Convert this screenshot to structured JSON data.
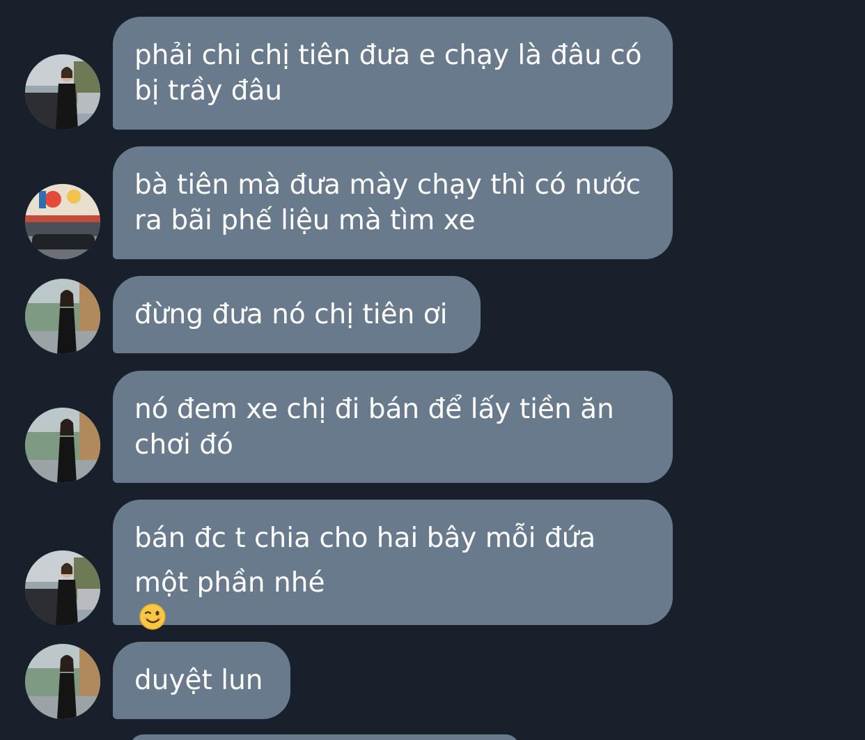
{
  "messages": [
    {
      "avatar": "avatar-photo-black-outfit-street",
      "lines": [
        "phải chi chị tiên đưa e chạy là đâu có",
        "bị trầy đâu"
      ]
    },
    {
      "avatar": "avatar-photo-colorful-storefront",
      "lines": [
        "bà tiên mà đưa mày chạy thì có nước",
        "ra bãi phế liệu mà tìm xe"
      ]
    },
    {
      "avatar": "avatar-photo-black-dress-riverside",
      "lines": [
        "đừng đưa nó chị tiên ơi"
      ]
    },
    {
      "avatar": "avatar-photo-black-dress-riverside",
      "lines": [
        "nó đem xe chị đi bán để lấy tiền ăn",
        "chơi đó"
      ]
    },
    {
      "avatar": "avatar-photo-black-outfit-street",
      "lines": [
        "bán đc t chia cho hai bây mỗi đứa",
        "một phần nhé"
      ],
      "emoji": "winking-face-emoji"
    },
    {
      "avatar": "avatar-photo-black-dress-riverside",
      "lines": [
        "duyệt lun"
      ]
    }
  ],
  "colors": {
    "background": "#18202b",
    "bubble": "#687a8c",
    "text": "#ffffff"
  }
}
